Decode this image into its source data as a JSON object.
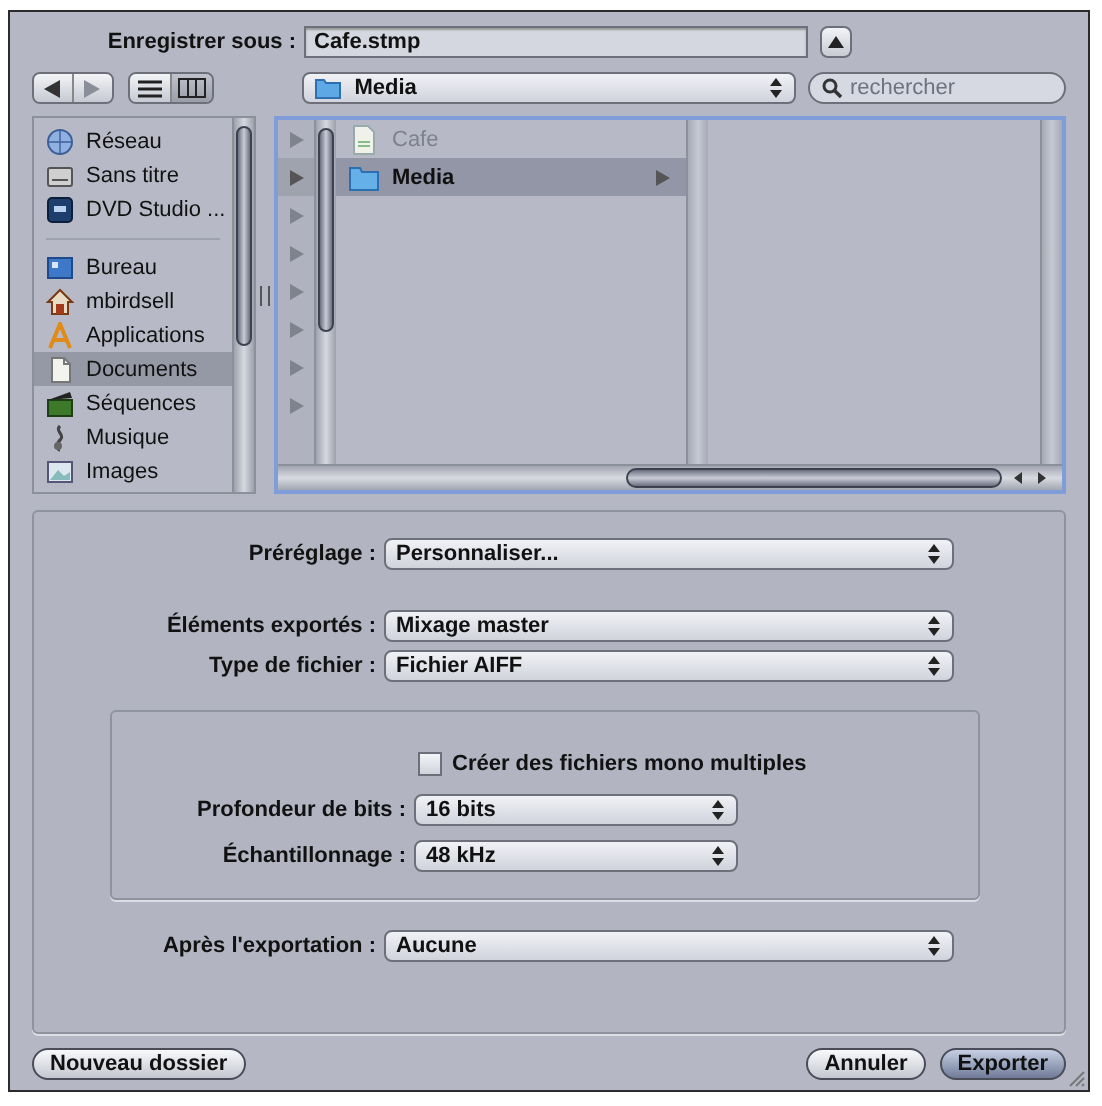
{
  "save_as": {
    "label": "Enregistrer sous :",
    "value": "Cafe.stmp",
    "expanded": true
  },
  "navigation": [
    {
      "kind": "back",
      "disabled": false
    },
    {
      "kind": "forward",
      "disabled": true
    }
  ],
  "view_modes": [
    {
      "kind": "list",
      "selected": false
    },
    {
      "kind": "columns",
      "selected": true
    }
  ],
  "path_popup": {
    "value": "Media"
  },
  "search": {
    "placeholder": "rechercher"
  },
  "sidebar": {
    "items": [
      {
        "label": "Réseau",
        "kind": "network",
        "selected": false
      },
      {
        "label": "Sans titre",
        "kind": "drive",
        "selected": false
      },
      {
        "label": "DVD Studio ...",
        "kind": "dvd",
        "selected": false
      },
      {
        "kind": "divider"
      },
      {
        "label": "Bureau",
        "kind": "desktop",
        "selected": false
      },
      {
        "label": "mbirdsell",
        "kind": "home",
        "selected": false
      },
      {
        "label": "Applications",
        "kind": "applications",
        "selected": false
      },
      {
        "label": "Documents",
        "kind": "documents",
        "selected": true
      },
      {
        "label": "Séquences",
        "kind": "movies",
        "selected": false
      },
      {
        "label": "Musique",
        "kind": "music",
        "selected": false
      },
      {
        "label": "Images",
        "kind": "pictures",
        "selected": false
      }
    ]
  },
  "column_1": {
    "rows": [
      {
        "selected": false
      },
      {
        "selected": true
      },
      {
        "selected": false
      },
      {
        "selected": false
      },
      {
        "selected": false
      },
      {
        "selected": false
      },
      {
        "selected": false
      },
      {
        "selected": false
      }
    ]
  },
  "column_2": {
    "rows": [
      {
        "label": "Cafe",
        "kind": "file",
        "disabled": true,
        "selected": false
      },
      {
        "label": "Media",
        "kind": "folder",
        "disabled": false,
        "selected": true
      }
    ]
  },
  "options": [
    {
      "kind": "popup",
      "label": "Préréglage :",
      "value": "Personnaliser..."
    },
    {
      "kind": "spacer"
    },
    {
      "kind": "popup",
      "label": "Éléments exportés :",
      "value": "Mixage master"
    },
    {
      "kind": "popup",
      "label": "Type de fichier :",
      "value": "Fichier AIFF"
    },
    {
      "kind": "group",
      "items": [
        {
          "kind": "checkbox",
          "label": "Créer des fichiers mono multiples",
          "checked": false
        },
        {
          "kind": "popup",
          "label": "Profondeur de bits :",
          "value": "16 bits"
        },
        {
          "kind": "popup",
          "label": "Échantillonnage :",
          "value": "48 kHz"
        }
      ]
    },
    {
      "kind": "popup",
      "label": "Après l'exportation :",
      "value": "Aucune"
    }
  ],
  "buttons": [
    {
      "label": "Nouveau dossier",
      "default": false,
      "kind": "auxiliary"
    },
    {
      "label": "Annuler",
      "default": false,
      "kind": "action"
    },
    {
      "label": "Exporter",
      "default": true,
      "kind": "action"
    }
  ]
}
